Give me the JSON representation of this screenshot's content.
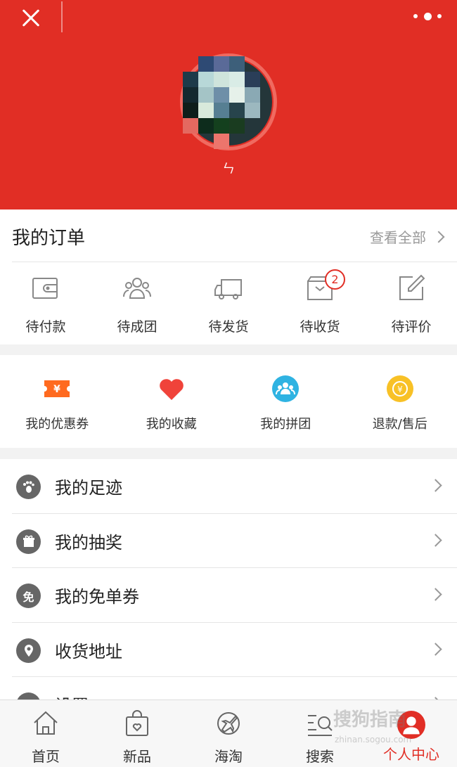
{
  "colors": {
    "brand": "#e12e25",
    "coupon": "#ff6a1f",
    "heart": "#f0433a",
    "group": "#2fb3e2",
    "refund": "#f8c126"
  },
  "header": {
    "username": "ㄣ"
  },
  "orders": {
    "title": "我的订单",
    "view_all": "查看全部",
    "items": [
      {
        "label": "待付款",
        "icon": "wallet-icon"
      },
      {
        "label": "待成团",
        "icon": "group-icon"
      },
      {
        "label": "待发货",
        "icon": "truck-icon"
      },
      {
        "label": "待收货",
        "icon": "package-icon",
        "badge": "2"
      },
      {
        "label": "待评价",
        "icon": "edit-icon"
      }
    ]
  },
  "features": [
    {
      "label": "我的优惠券",
      "icon": "coupon-icon"
    },
    {
      "label": "我的收藏",
      "icon": "heart-icon"
    },
    {
      "label": "我的拼团",
      "icon": "group-buy-icon"
    },
    {
      "label": "退款/售后",
      "icon": "refund-icon"
    }
  ],
  "menu": [
    {
      "label": "我的足迹",
      "icon": "footprint-icon"
    },
    {
      "label": "我的抽奖",
      "icon": "gift-icon"
    },
    {
      "label": "我的免单券",
      "icon": "free-icon",
      "icon_text": "免"
    },
    {
      "label": "收货地址",
      "icon": "location-icon"
    },
    {
      "label": "设置",
      "icon": "settings-icon"
    }
  ],
  "nav": [
    {
      "label": "首页",
      "icon": "home-icon"
    },
    {
      "label": "新品",
      "icon": "bag-icon"
    },
    {
      "label": "海淘",
      "icon": "plane-icon"
    },
    {
      "label": "搜索",
      "icon": "search-icon"
    },
    {
      "label": "个人中心",
      "icon": "profile-icon",
      "active": true
    }
  ],
  "watermark": {
    "text": "搜狗指南",
    "url": "zhinan.sogou.com"
  }
}
